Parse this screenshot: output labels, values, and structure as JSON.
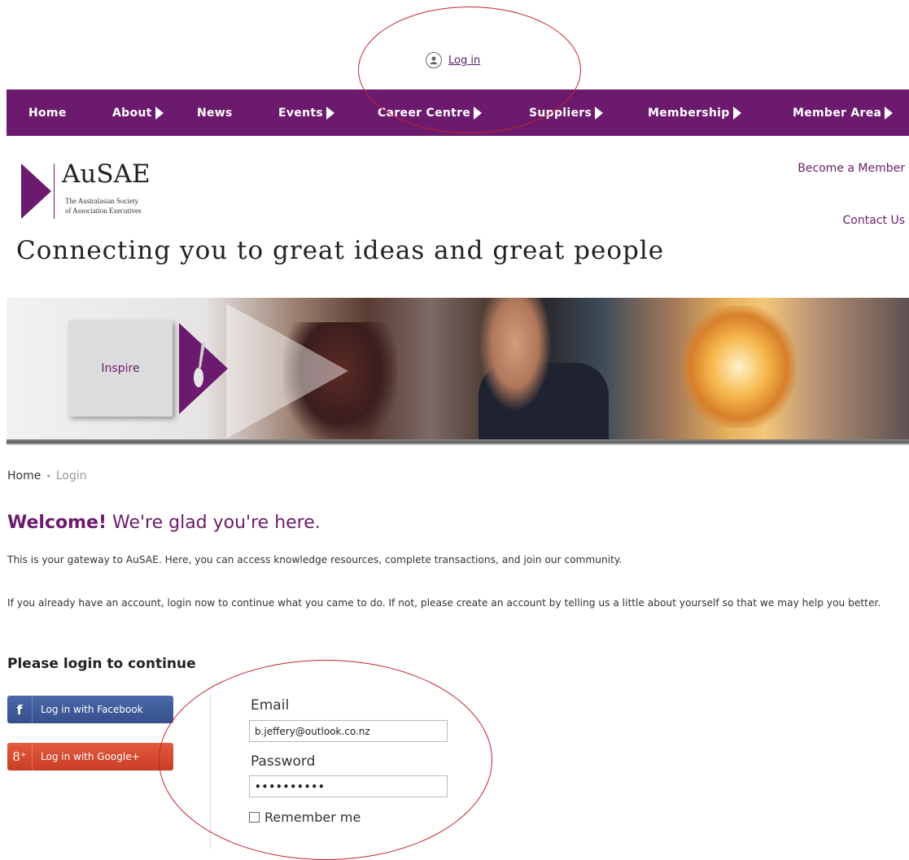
{
  "top": {
    "login_link": "Log in"
  },
  "nav": {
    "items": [
      {
        "label": "Home",
        "has_arrow": false
      },
      {
        "label": "About",
        "has_arrow": true
      },
      {
        "label": "News",
        "has_arrow": false
      },
      {
        "label": "Events",
        "has_arrow": true
      },
      {
        "label": "Career Centre",
        "has_arrow": true
      },
      {
        "label": "Suppliers",
        "has_arrow": true
      },
      {
        "label": "Membership",
        "has_arrow": true
      },
      {
        "label": "Member Area",
        "has_arrow": true
      }
    ]
  },
  "logo": {
    "name": "AuSAE",
    "subtitle_line1": "The Australasian Society",
    "subtitle_line2": "of Association Executives"
  },
  "header_links": {
    "become_member": "Become a Member",
    "contact_us": "Contact Us"
  },
  "tagline": "Connecting you to great ideas and great people",
  "banner": {
    "label": "Inspire"
  },
  "breadcrumb": {
    "home": "Home",
    "separator": "•",
    "current": "Login"
  },
  "welcome": {
    "bold": "Welcome!",
    "rest": " We're glad you're here."
  },
  "paragraphs": {
    "p1": "This is your gateway to AuSAE. Here, you can access knowledge resources, complete transactions, and join our community.",
    "p2": "If you already have an account, login now to continue what you came to do. If not, please create an account by telling us a little about yourself so that we may help you better."
  },
  "login": {
    "heading": "Please login to continue",
    "facebook_label": "Log in with Facebook",
    "facebook_icon_glyph": "f",
    "google_label": "Log in with Google+",
    "google_icon_glyph": "8⁺",
    "email_label": "Email",
    "email_value": "b.jeffery@outlook.co.nz",
    "password_label": "Password",
    "password_value": "••••••••••",
    "remember_label": "Remember me"
  },
  "colors": {
    "brand_purple": "#6c1a6e",
    "facebook_blue": "#3b5998",
    "google_red": "#dd4b39",
    "annotation_red": "#c0262c"
  }
}
